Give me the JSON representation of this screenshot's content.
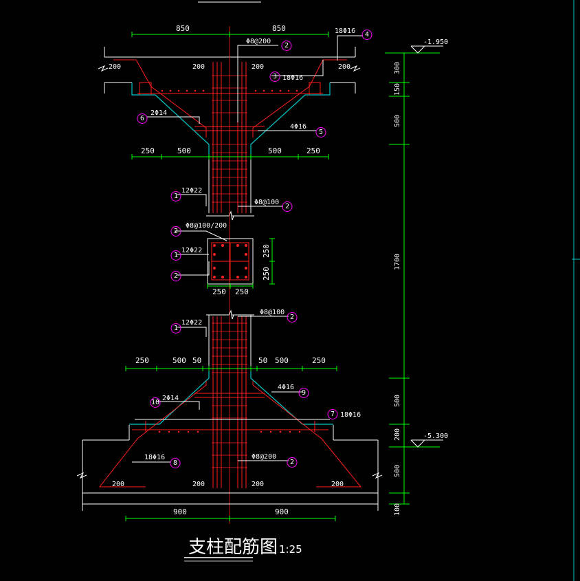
{
  "colors": {
    "background": "#000000",
    "concrete": "#ffffff",
    "rebar": "#ff2020",
    "formwork": "#00c8c8",
    "dimension": "#00ff00",
    "tag_circle": "#ff00ff",
    "text": "#ffffff"
  },
  "title": {
    "main": "支柱配筋图",
    "scale": "1:25"
  },
  "elevations": {
    "top": "-1.950",
    "bottom": "-5.300"
  },
  "dims": {
    "top_850_left": "850",
    "top_850_right": "850",
    "top_200_a": "200",
    "top_200_b": "200",
    "top_200_c": "200",
    "top_200_d": "200",
    "haunch_250_l": "250",
    "haunch_500_l": "500",
    "haunch_500_r": "500",
    "haunch_250_r": "250",
    "sec_250_a": "250",
    "sec_250_b": "250",
    "sec_250_v1": "250",
    "sec_250_v2": "250",
    "low_250_l": "250",
    "low_500_l": "500",
    "low_50_l": "50",
    "low_50_r": "50",
    "low_500_r": "500",
    "low_250_r": "250",
    "bot_200_a": "200",
    "bot_200_b": "200",
    "bot_200_c": "200",
    "bot_200_d": "200",
    "bot_900_l": "900",
    "bot_900_r": "900",
    "v_300": "300",
    "v_150": "150",
    "v_500_top": "500",
    "v_1700": "1700",
    "v_500_bot": "500",
    "v_200": "200",
    "v_500_base": "500",
    "v_100": "100"
  },
  "labels": {
    "l_18phi16_top": "18Φ16",
    "l_phi8_200_top": "Φ8@200",
    "l_18phi16_mid": "18Φ16",
    "l_2phi14_top": "2Φ14",
    "l_4phi16_top": "4Φ16",
    "l_12phi22_top": "12Φ22",
    "l_phi8_100_top": "Φ8@100",
    "l_phi8_100_200": "Φ8@100/200",
    "l_12phi22_sec": "12Φ22",
    "l_12phi22_bot": "12Φ22",
    "l_phi8_100_bot": "Φ8@100",
    "l_4phi16_bot": "4Φ16",
    "l_2phi14_bot": "2Φ14",
    "l_18phi16_r": "18Φ16",
    "l_18phi16_base": "18Φ16",
    "l_phi8_200_bot": "Φ8@200"
  },
  "tags": {
    "t4": "4",
    "t2a": "2",
    "t3": "3",
    "t6": "6",
    "t5": "5",
    "t1a": "1",
    "t2b": "2",
    "t2c": "2",
    "t1b": "1",
    "t2d": "2",
    "t1c": "1",
    "t2e": "2",
    "t9": "9",
    "t10": "10",
    "t7": "7",
    "t8": "8",
    "t2f": "2"
  }
}
